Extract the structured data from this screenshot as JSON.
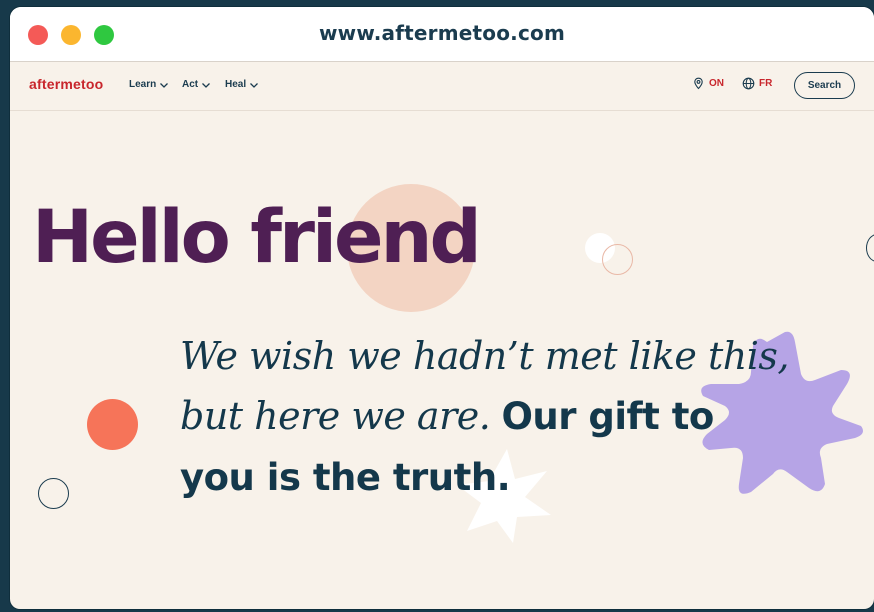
{
  "browser": {
    "url": "www.aftermetoo.com"
  },
  "nav": {
    "logo": "aftermetoo",
    "links": [
      {
        "label": "Learn"
      },
      {
        "label": "Act"
      },
      {
        "label": "Heal"
      }
    ],
    "location": "ON",
    "language": "FR",
    "search_label": "Search"
  },
  "hero": {
    "headline": "Hello friend",
    "tagline_italic_1": "We wish we hadn’t met like this,",
    "tagline_italic_2": "but here we are.",
    "tagline_bold_1": "Our gift to",
    "tagline_bold_2": "you is the truth."
  },
  "colors": {
    "brand_red": "#c8262c",
    "headline_purple": "#4f1f54",
    "text_navy": "#14384b",
    "background_cream": "#f8f2ea",
    "accent_peach": "#f3d4c3",
    "accent_orange": "#f67459",
    "accent_lavender": "#b6a4e6"
  }
}
